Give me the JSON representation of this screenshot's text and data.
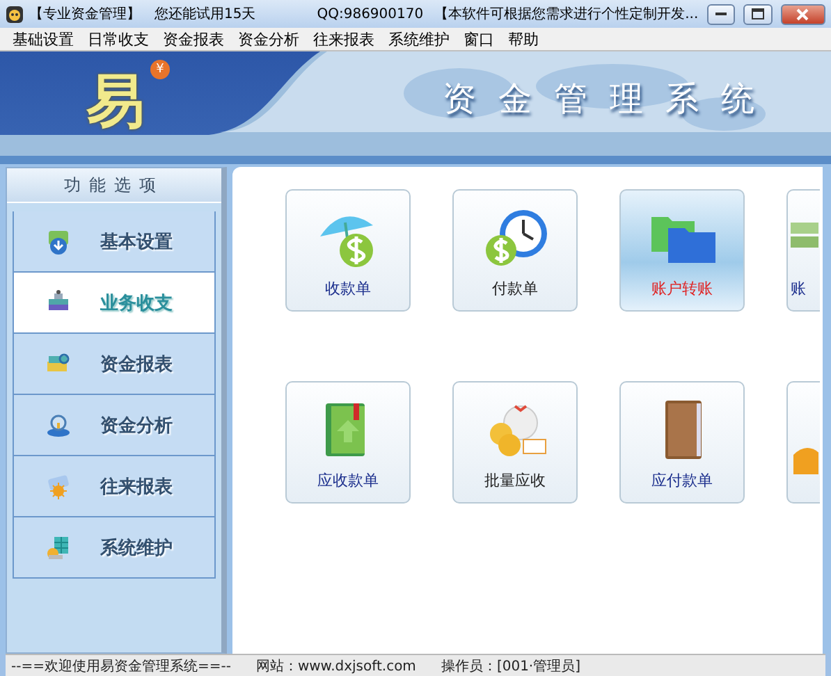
{
  "window": {
    "title": "【专业资金管理】",
    "trial": "您还能试用15天",
    "qq": "QQ:986900170",
    "notice": "【本软件可根据您需求进行个性定制开发..."
  },
  "menu": [
    "基础设置",
    "日常收支",
    "资金报表",
    "资金分析",
    "往来报表",
    "系统维护",
    "窗口",
    "帮助"
  ],
  "banner": {
    "logo": "易",
    "logo_badge": "¥",
    "title": "资金管理系统"
  },
  "sidebar": {
    "title": "功能选项",
    "items": [
      {
        "label": "基本设置",
        "selected": false
      },
      {
        "label": "业务收支",
        "selected": true
      },
      {
        "label": "资金报表",
        "selected": false
      },
      {
        "label": "资金分析",
        "selected": false
      },
      {
        "label": "往来报表",
        "selected": false
      },
      {
        "label": "系统维护",
        "selected": false
      }
    ]
  },
  "tiles": [
    {
      "label": "收款单",
      "selected": false
    },
    {
      "label": "付款单",
      "selected": false
    },
    {
      "label": "账户转账",
      "selected": true
    },
    {
      "label": "账",
      "selected": false
    },
    {
      "label": "应收款单",
      "selected": false
    },
    {
      "label": "批量应收",
      "selected": false
    },
    {
      "label": "应付款单",
      "selected": false
    },
    {
      "selected": false
    }
  ],
  "status_bar": [
    "--==欢迎使用易资金管理系统==--",
    "网站：www.dxjsoft.com",
    "操作员：[001·管理员]"
  ]
}
